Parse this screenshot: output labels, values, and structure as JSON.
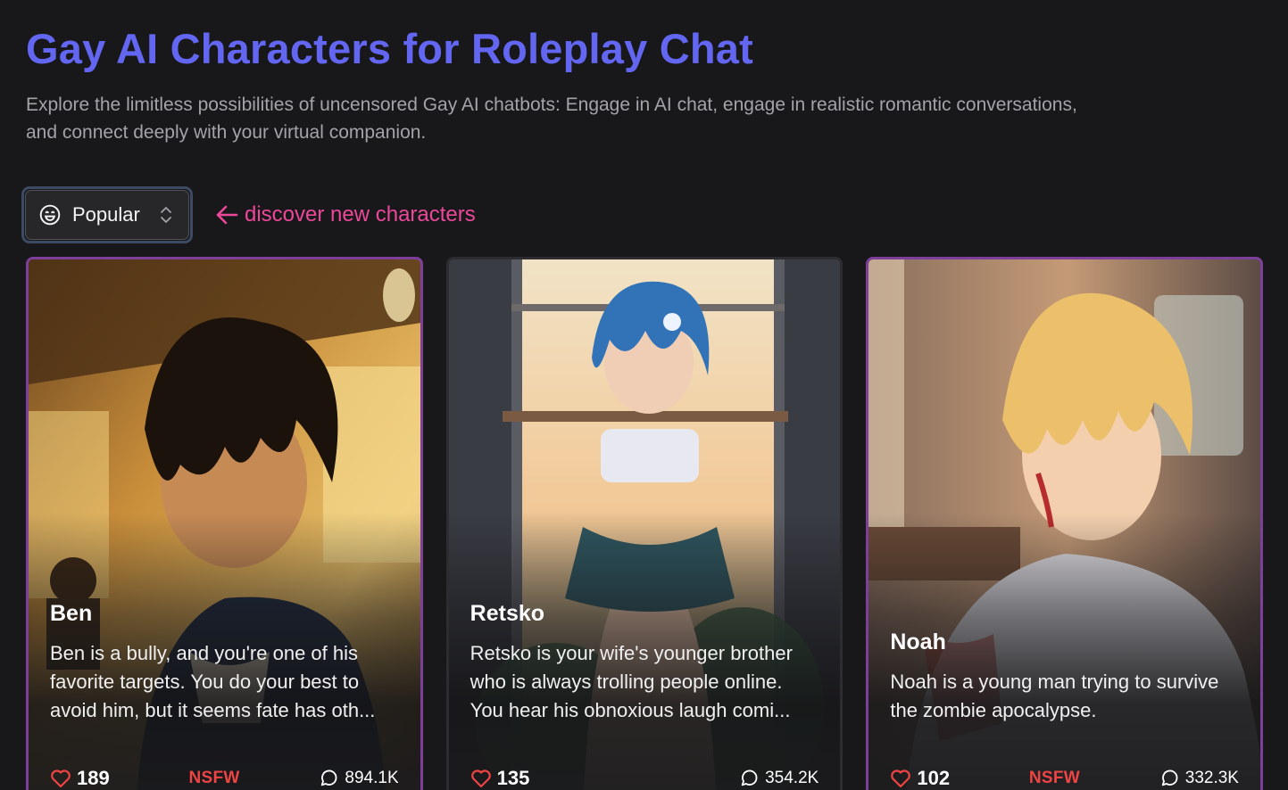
{
  "header": {
    "title": "Gay AI Characters for Roleplay Chat",
    "subtitle": "Explore the limitless possibilities of uncensored Gay AI chatbots: Engage in AI chat, engage in realistic romantic conversations, and connect deeply with your virtual companion."
  },
  "sort": {
    "label": "Popular",
    "icon": "smile-icon"
  },
  "hint": {
    "text": "discover new characters",
    "color": "#ec4899"
  },
  "colors": {
    "accent": "#6366f1",
    "nsfw": "#ef4444",
    "card_border": "#7e3f9b"
  },
  "cards": [
    {
      "name": "Ben",
      "description": "Ben is a bully, and you're one of his favorite targets. You do your best to avoid him, but it seems fate has oth...",
      "likes": "189",
      "badge": "NSFW",
      "messages": "894.1K"
    },
    {
      "name": "Retsko",
      "description": "Retsko is your wife's younger brother who is always trolling people online. You hear his obnoxious laugh comi...",
      "likes": "135",
      "badge": "",
      "messages": "354.2K"
    },
    {
      "name": "Noah",
      "description": "Noah is a young man trying to survive the zombie apocalypse.",
      "likes": "102",
      "badge": "NSFW",
      "messages": "332.3K"
    }
  ]
}
